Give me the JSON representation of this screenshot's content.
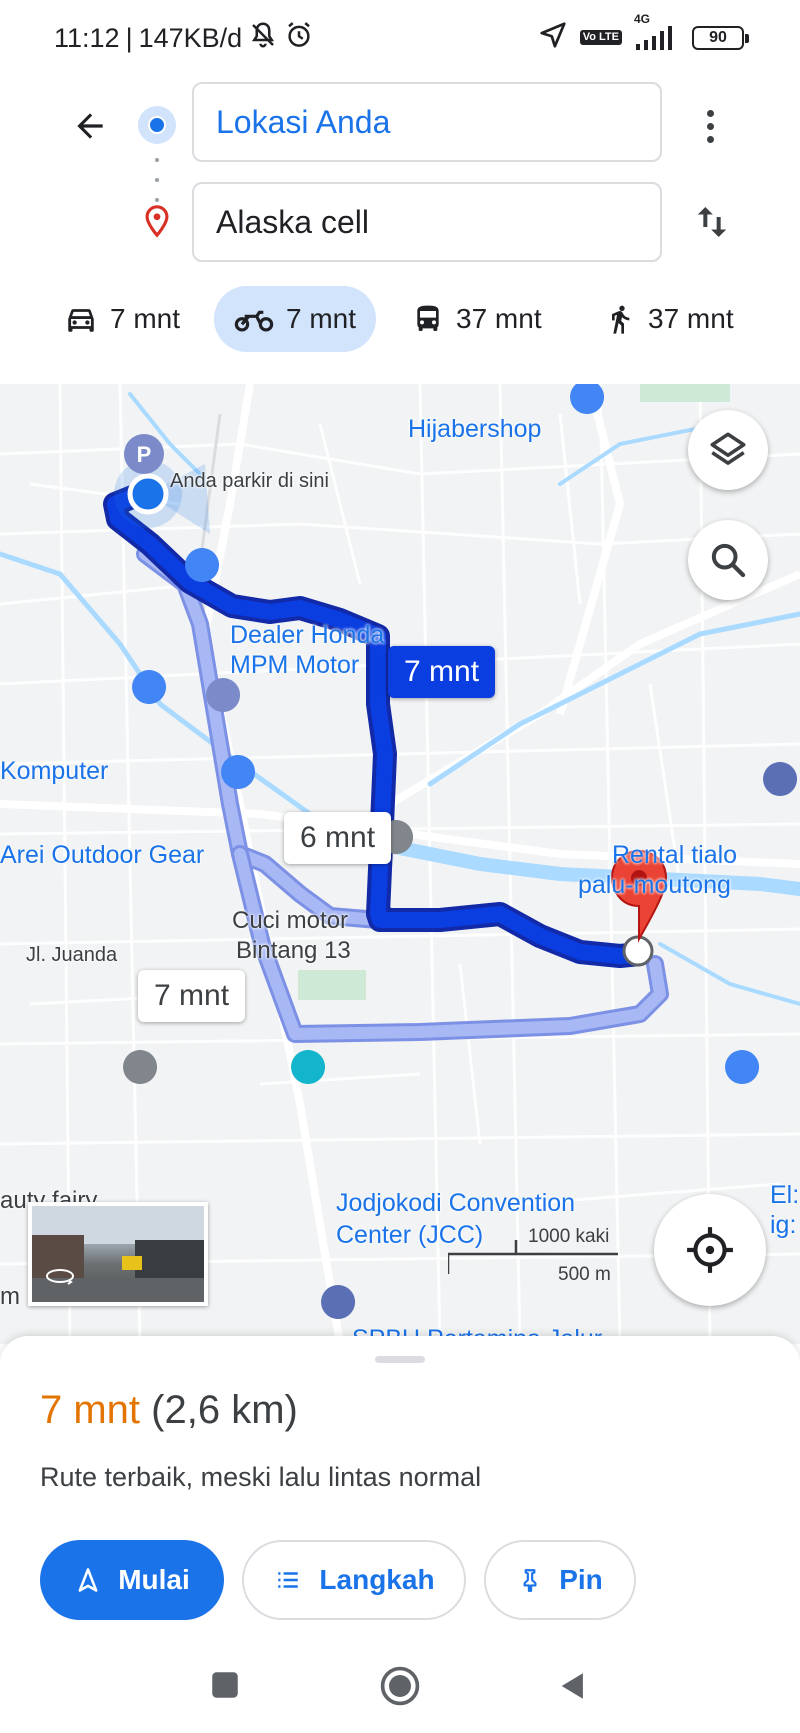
{
  "status_bar": {
    "time": "11:12",
    "separator": "|",
    "net_speed": "147KB/d",
    "volte": "Vo LTE",
    "network": "4G",
    "battery": "90"
  },
  "header": {
    "origin_value": "Lokasi Anda",
    "destination_value": "Alaska cell"
  },
  "travel_modes": [
    {
      "mode": "car",
      "icon": "car-icon",
      "label": "7 mnt",
      "selected": false
    },
    {
      "mode": "motorcycle",
      "icon": "motorcycle-icon",
      "label": "7 mnt",
      "selected": true
    },
    {
      "mode": "transit",
      "icon": "bus-icon",
      "label": "37 mnt",
      "selected": false
    },
    {
      "mode": "walk",
      "icon": "walk-icon",
      "label": "37 mnt",
      "selected": false
    }
  ],
  "map": {
    "places": {
      "hijabershop": "Hijabershop",
      "parking": "Anda parkir di sini",
      "dealer_honda_1": "Dealer Honda",
      "dealer_honda_2": "MPM Motor",
      "komputer": "Komputer",
      "arei": "Arei Outdoor Gear",
      "rental_1": "Rental tialo",
      "rental_2": "palu-moutong",
      "cuci_motor_1": "Cuci motor",
      "cuci_motor_2": "Bintang 13",
      "jl_juanda": "Jl. Juanda",
      "jcc_1": "Jodjokodi Convention",
      "jcc_2": "Center (JCC)",
      "beauty_fairy": "auty fairy",
      "spbu": "SPBU Pertamina Jalur",
      "edge_el": "El:",
      "edge_ig": "ig:",
      "edge_m": "m"
    },
    "route_tags": {
      "primary": "7 mnt",
      "alt_1": "6 mnt",
      "alt_2": "7 mnt"
    },
    "scale": {
      "feet": "1000 kaki",
      "meters": "500 m"
    },
    "colors": {
      "primary_route": "#0b3ee0",
      "alt_route": "#a8b8f4",
      "water": "#aadaff",
      "destination_pin": "#ea4335"
    }
  },
  "sheet": {
    "eta": "7 mnt",
    "distance": "(2,6 km)",
    "summary": "Rute terbaik, meski lalu lintas normal",
    "start_label": "Mulai",
    "steps_label": "Langkah",
    "pin_label": "Pin"
  }
}
